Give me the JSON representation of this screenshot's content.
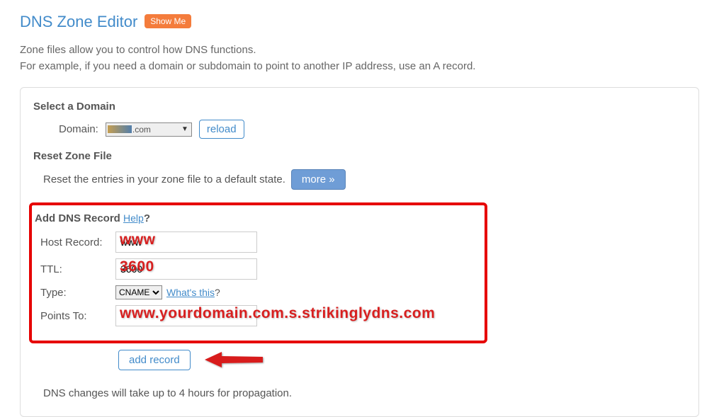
{
  "page": {
    "title": "DNS Zone Editor",
    "show_me_label": "Show Me",
    "intro_line1": "Zone files allow you to control how DNS functions.",
    "intro_line2": "For example, if you need a domain or subdomain to point to another IP address, use an A record."
  },
  "select_domain": {
    "title": "Select a Domain",
    "domain_label": "Domain:",
    "domain_suffix": ".com",
    "reload_label": "reload"
  },
  "reset_zone": {
    "title": "Reset Zone File",
    "text": "Reset the entries in your zone file to a default state.",
    "more_label": "more »"
  },
  "add_record": {
    "title": "Add DNS Record",
    "help_label": "Help",
    "help_q": "?",
    "host_label": "Host Record:",
    "host_value": "www",
    "host_overlay": "www",
    "ttl_label": "TTL:",
    "ttl_value": "3600",
    "ttl_overlay": "3600",
    "type_label": "Type:",
    "type_value": "CNAME",
    "whats_this_label": "What's this",
    "whats_this_q": "?",
    "points_to_label": "Points To:",
    "points_to_value": "",
    "points_to_overlay": "www.yourdomain.com.s.strikinglydns.com",
    "add_button_label": "add record"
  },
  "footnote": "DNS changes will take up to 4 hours for propagation."
}
